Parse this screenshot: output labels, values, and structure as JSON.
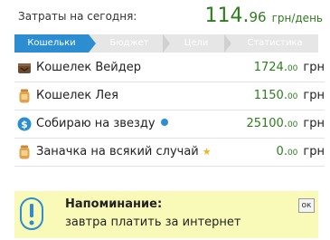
{
  "header": {
    "label": "Затраты на сегодня:",
    "total_int": "114.",
    "total_dec": "96",
    "total_unit": "грн/день"
  },
  "tabs": [
    {
      "label": "Кошельки",
      "active": true
    },
    {
      "label": "Бюджет",
      "active": false
    },
    {
      "label": "Цели",
      "active": false
    },
    {
      "label": "Статистика",
      "active": false
    }
  ],
  "wallets": [
    {
      "name": "Кошелек Вейдер",
      "amount_int": "1724.",
      "amount_dec": "00",
      "currency": "грн",
      "icon": "wallet-icon"
    },
    {
      "name": "Кошелек Лея",
      "amount_int": "1150.",
      "amount_dec": "00",
      "currency": "грн",
      "icon": "jar-icon"
    },
    {
      "name": "Собираю на звезду",
      "amount_int": "25100.",
      "amount_dec": "00",
      "currency": "грн",
      "icon": "dollar-coin-icon",
      "marker": "blue-dot"
    },
    {
      "name": "Заначка на всякий случай",
      "amount_int": "0.",
      "amount_dec": "00",
      "currency": "грн",
      "icon": "jar-icon",
      "marker": "star"
    }
  ],
  "reminder": {
    "title": "Напоминание:",
    "text": "завтра платить за интернет",
    "ok_label": "ок"
  },
  "colors": {
    "accent_blue": "#2c8ed0",
    "money_green": "#2e7d1e",
    "reminder_bg": "#fafab8",
    "star": "#f0b428"
  }
}
